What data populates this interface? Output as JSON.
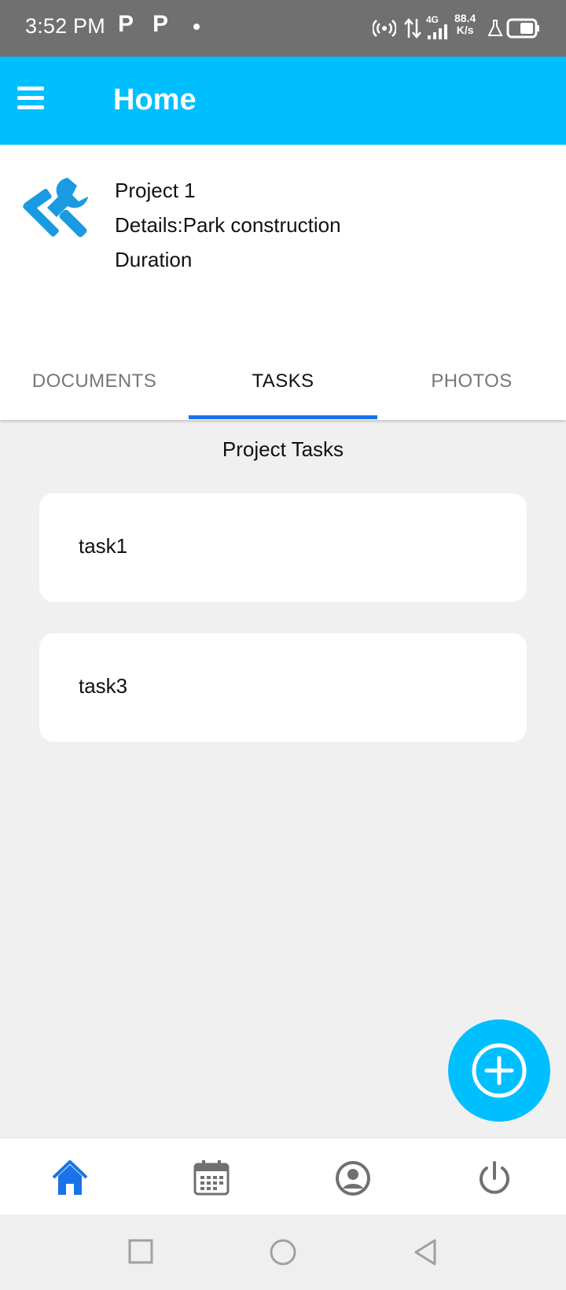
{
  "status_bar": {
    "time": "3:52 PM",
    "notif_1": "P",
    "notif_2": "P",
    "net_speed_value": "88.4",
    "net_speed_unit": "K/s",
    "network_type": "4G"
  },
  "app_bar": {
    "title": "Home"
  },
  "project": {
    "name": "Project 1",
    "details": "Details:Park construction",
    "duration": "Duration"
  },
  "tabs": [
    {
      "label": "DOCUMENTS"
    },
    {
      "label": "TASKS",
      "active": true
    },
    {
      "label": "PHOTOS"
    }
  ],
  "tasks_section": {
    "title": "Project Tasks",
    "items": [
      {
        "label": "task1"
      },
      {
        "label": "task3"
      }
    ]
  },
  "colors": {
    "accent": "#00bfff",
    "tab_indicator": "#1a73e8",
    "nav_active": "#1a73e8",
    "nav_inactive": "#707070"
  },
  "icons": {
    "project": "tools-icon",
    "fab": "add-circle-icon",
    "nav": [
      "home-icon",
      "calendar-icon",
      "account-icon",
      "power-icon"
    ]
  }
}
